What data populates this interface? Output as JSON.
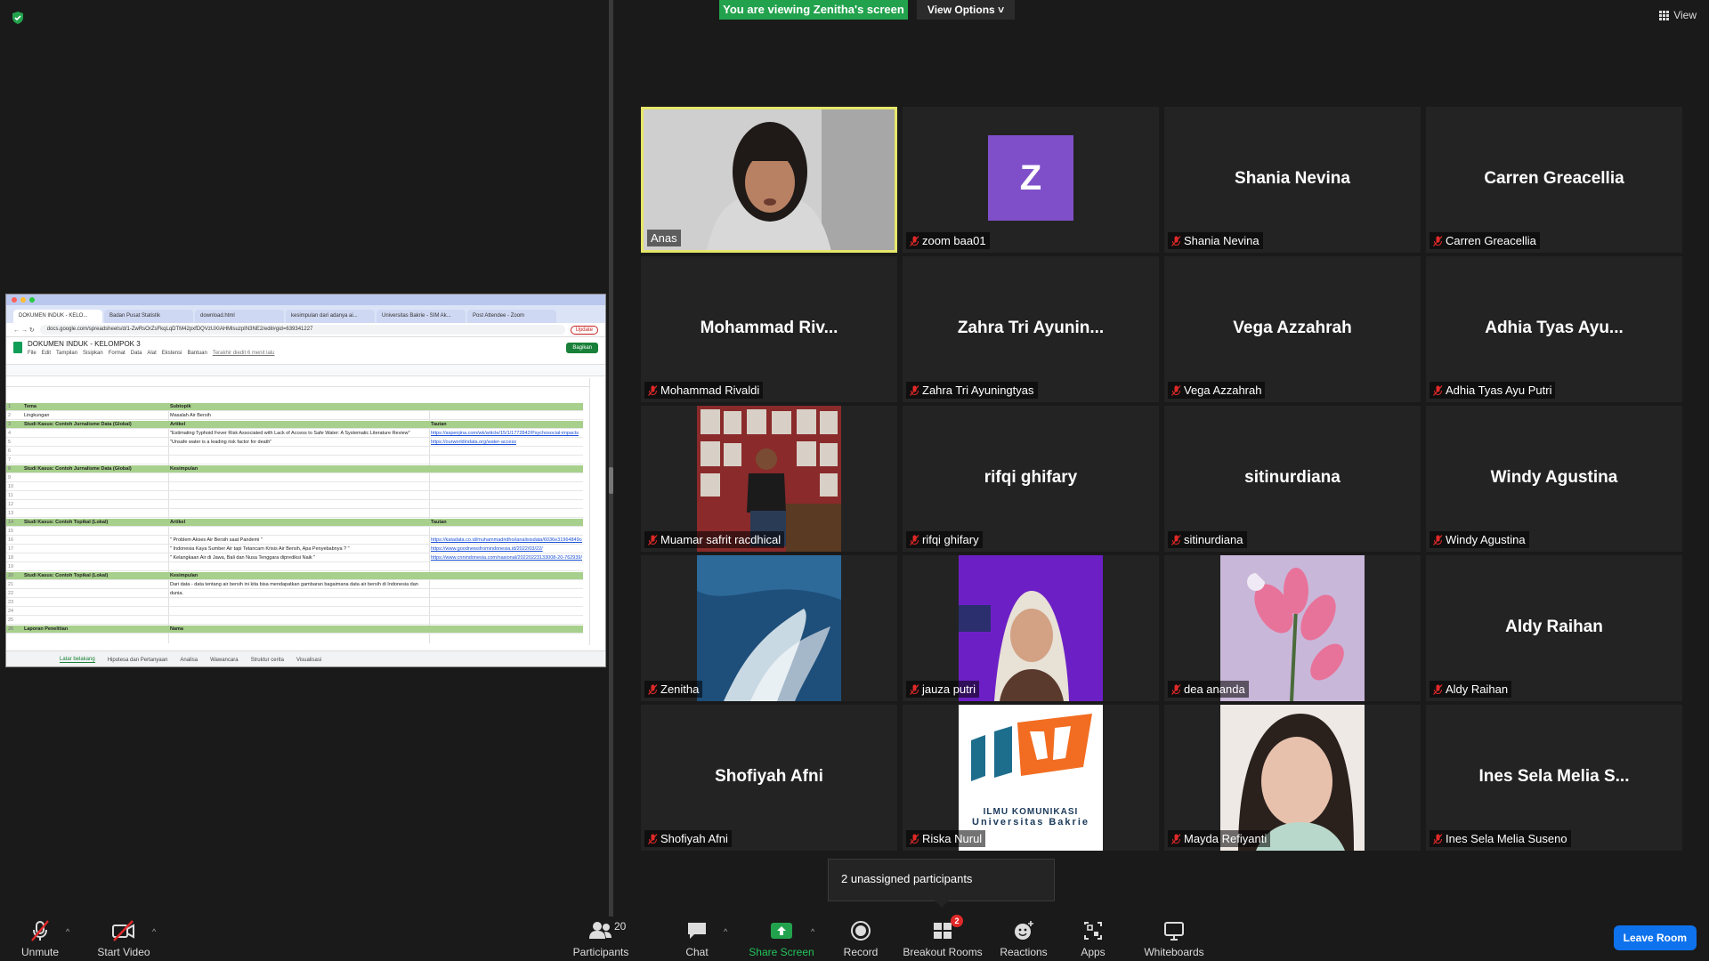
{
  "banner": {
    "viewing": "You are viewing Zenitha's screen",
    "view_options": "View Options",
    "view": "View"
  },
  "shared_screen": {
    "tabs": [
      "DOKUMEN INDUK - KELO...",
      "Badan Pusat Statistik",
      "download.html",
      "kesimpulan dari adanya ai...",
      "Universitas Bakrie - SIM Ak...",
      "Post Attendee - Zoom"
    ],
    "url": "docs.google.com/spreadsheets/d/1-ZwRsOrZsFkqLqDTM42pxfDQVzUXIAHMlsuzpIN3NE2/edit#gid=639341227",
    "update_label": "Update",
    "doc_title": "DOKUMEN INDUK - KELOMPOK 3",
    "menu": [
      "File",
      "Edit",
      "Tampilan",
      "Sisipkan",
      "Format",
      "Data",
      "Alat",
      "Ekstensi",
      "Bantuan",
      "Terakhir diedit 6 menit lalu"
    ],
    "share_label": "Bagikan",
    "rows": [
      {
        "n": "1",
        "c1": "Tema",
        "c2": "Subtopik",
        "c3": "",
        "green": true
      },
      {
        "n": "2",
        "c1": "Lingkungan",
        "c2": "Masalah Air Bersih",
        "c3": "",
        "green": false
      },
      {
        "n": "3",
        "c1": "Studi Kasus: Contoh Jurnalisme Data (Global)",
        "c2": "Artikel",
        "c3": "Tautan",
        "green": true
      },
      {
        "n": "4",
        "c1": "",
        "c2": "\"Estimating Typhoid Fever Risk Associated with Lack of Access to Safe Water: A Systematic Literature Review\"",
        "c3": "https://aspenjina.com/wk/article/15/1/1772842/Psychosocial-impacts",
        "green": false
      },
      {
        "n": "5",
        "c1": "",
        "c2": "\"Unsafe water is a leading risk factor for death\"",
        "c3": "https://ourworldindata.org/water-access",
        "green": false
      },
      {
        "n": "6",
        "c1": "",
        "c2": "",
        "c3": "",
        "green": false
      },
      {
        "n": "7",
        "c1": "",
        "c2": "",
        "c3": "",
        "green": false
      },
      {
        "n": "8",
        "c1": "Studi Kasus: Contoh Jurnalisme Data (Global)",
        "c2": "Kesimpulan",
        "c3": "",
        "green": true
      },
      {
        "n": "9",
        "c1": "",
        "c2": "",
        "c3": "",
        "green": false
      },
      {
        "n": "10",
        "c1": "",
        "c2": "",
        "c3": "",
        "green": false
      },
      {
        "n": "11",
        "c1": "",
        "c2": "",
        "c3": "",
        "green": false
      },
      {
        "n": "12",
        "c1": "",
        "c2": "",
        "c3": "",
        "green": false
      },
      {
        "n": "13",
        "c1": "",
        "c2": "",
        "c3": "",
        "green": false
      },
      {
        "n": "14",
        "c1": "Studi Kasus: Contoh Topikal (Lokal)",
        "c2": "Artikel",
        "c3": "Tautan",
        "green": true
      },
      {
        "n": "15",
        "c1": "",
        "c2": "",
        "c3": "",
        "green": false
      },
      {
        "n": "16",
        "c1": "",
        "c2": "\" Problem Akses Air Bersih saat Pandemi \"",
        "c3": "https://katadata.co.id/muhammadridhoi/analisisdata/6036e31964849cc",
        "green": false
      },
      {
        "n": "17",
        "c1": "",
        "c2": "\" Indonesia Kaya Sumber Air tapi Tetancam Krisis Air Bersih, Apa Penyebabnya ? \"",
        "c3": "https://www.goodnewsfromindonesia.id/2022/03/22/",
        "green": false
      },
      {
        "n": "18",
        "c1": "",
        "c2": "\" Kelangkaan Air di Jawa, Bali dan Nusa Tenggara diprediksi Naik \"",
        "c3": "https://www.cnnindonesia.com/nasional/20220223133008-20-762939/",
        "green": false
      },
      {
        "n": "19",
        "c1": "",
        "c2": "",
        "c3": "",
        "green": false
      },
      {
        "n": "20",
        "c1": "Studi Kasus: Contoh Topikal (Lokal)",
        "c2": "Kesimpulan",
        "c3": "",
        "green": true
      },
      {
        "n": "21",
        "c1": "",
        "c2": "Dari data - data tentang air bersih ini kita bisa mendapatkan gambaran bagaimana data air bersih di Indonesia dan",
        "c3": "",
        "green": false
      },
      {
        "n": "22",
        "c1": "",
        "c2": "dunia.",
        "c3": "",
        "green": false
      },
      {
        "n": "23",
        "c1": "",
        "c2": "",
        "c3": "",
        "green": false
      },
      {
        "n": "24",
        "c1": "",
        "c2": "",
        "c3": "",
        "green": false
      },
      {
        "n": "25",
        "c1": "",
        "c2": "",
        "c3": "",
        "green": false
      },
      {
        "n": "26",
        "c1": "Laporan Penelitian",
        "c2": "Nama",
        "c3": "",
        "green": true
      }
    ],
    "sheet_tabs": [
      "Latar belakang",
      "Hipotesa dan Pertanyaan",
      "Analisa",
      "Wawancara",
      "Struktur cerita",
      "Visualisasi"
    ]
  },
  "participants": [
    {
      "label": "Anas",
      "big": "",
      "type": "video-girl",
      "muted": false,
      "active": true
    },
    {
      "label": "zoom baa01",
      "big": "",
      "type": "avatar-z",
      "avatar_letter": "Z",
      "muted": true
    },
    {
      "label": "Shania Nevina",
      "big": "Shania Nevina",
      "type": "name",
      "muted": true
    },
    {
      "label": "Carren Greacellia",
      "big": "Carren Greacellia",
      "type": "name",
      "muted": true
    },
    {
      "label": "Mohammad Rivaldi",
      "big": "Mohammad Riv...",
      "type": "name",
      "muted": true
    },
    {
      "label": "Zahra Tri Ayuningtyas",
      "big": "Zahra Tri Ayunin...",
      "type": "name",
      "muted": true
    },
    {
      "label": "Vega Azzahrah",
      "big": "Vega Azzahrah",
      "type": "name",
      "muted": true
    },
    {
      "label": "Adhia Tyas Ayu Putri",
      "big": "Adhia Tyas Ayu...",
      "type": "name",
      "muted": true
    },
    {
      "label": "Muamar safrit racdhical",
      "big": "",
      "type": "photo-posters",
      "muted": true
    },
    {
      "label": "rifqi ghifary",
      "big": "rifqi ghifary",
      "type": "name",
      "muted": true
    },
    {
      "label": "sitinurdiana",
      "big": "sitinurdiana",
      "type": "name",
      "muted": true
    },
    {
      "label": "Windy Agustina",
      "big": "Windy Agustina",
      "type": "name",
      "muted": true
    },
    {
      "label": "Zenitha",
      "big": "",
      "type": "photo-sea",
      "muted": true
    },
    {
      "label": "jauza putri",
      "big": "",
      "type": "photo-hijab",
      "muted": true
    },
    {
      "label": "dea ananda",
      "big": "",
      "type": "photo-flower",
      "muted": true
    },
    {
      "label": "Aldy Raihan",
      "big": "Aldy Raihan",
      "type": "name",
      "muted": true
    },
    {
      "label": "Shofiyah Afni",
      "big": "Shofiyah Afni",
      "type": "name",
      "muted": true
    },
    {
      "label": "Riska Nurul",
      "big": "",
      "type": "photo-logo",
      "logo_line1": "ILMU KOMUNIKASI",
      "logo_line2": "Universitas Bakrie",
      "muted": true
    },
    {
      "label": "Mayda Refiyanti",
      "big": "",
      "type": "photo-selfie",
      "muted": true
    },
    {
      "label": "Ines Sela Melia Suseno",
      "big": "Ines Sela Melia S...",
      "type": "name",
      "muted": true
    }
  ],
  "unassigned": "2 unassigned participants",
  "toolbar": {
    "unmute": "Unmute",
    "start_video": "Start Video",
    "participants": "Participants",
    "participants_count": "20",
    "chat": "Chat",
    "share_screen": "Share Screen",
    "record": "Record",
    "breakout_rooms": "Breakout Rooms",
    "breakout_badge": "2",
    "reactions": "Reactions",
    "apps": "Apps",
    "whiteboards": "Whiteboards",
    "leave_room": "Leave Room"
  },
  "colors": {
    "accent_green": "#23a24d",
    "leave_blue": "#0e72ed",
    "active_border": "#e6e76a",
    "sheet_header_green": "#a7d08c"
  }
}
